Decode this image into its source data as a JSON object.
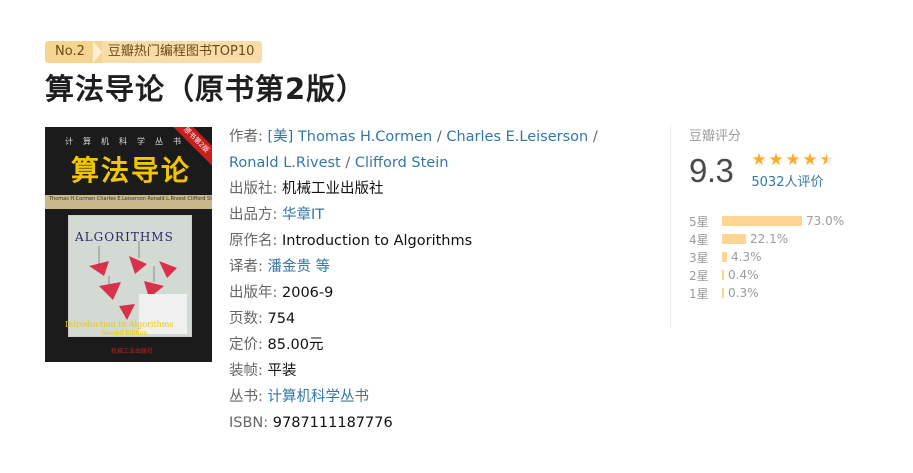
{
  "ranking": {
    "no": "No.2",
    "list": "豆瓣热门编程图书TOP10"
  },
  "title": "算法导论（原书第2版）",
  "cover": {
    "series": "计算机科学丛书",
    "title": "算法导论",
    "badge": "原书第2版",
    "authors": "Thomas H.Cormen  Charles E.Leiserson  Ronald L.Rivest  Clifford Stein",
    "algorithms": "ALGORITHMS",
    "english_title": "Introduction to Algorithms",
    "edition": "Second Edition",
    "publisher": "机械工业出版社"
  },
  "info": {
    "author_label": "作者:",
    "authors": [
      "[美] Thomas H.Cormen",
      "Charles E.Leiserson",
      "Ronald L.Rivest",
      "Clifford Stein"
    ],
    "publisher_label": "出版社:",
    "publisher": "机械工业出版社",
    "producer_label": "出品方:",
    "producer": "华章IT",
    "original_label": "原作名:",
    "original": "Introduction to Algorithms",
    "translator_label": "译者:",
    "translator": "潘金贵 等",
    "year_label": "出版年:",
    "year": "2006-9",
    "pages_label": "页数:",
    "pages": "754",
    "price_label": "定价:",
    "price": "85.00元",
    "binding_label": "装帧:",
    "binding": "平装",
    "series_label": "丛书:",
    "series": "计算机科学丛书",
    "isbn_label": "ISBN:",
    "isbn": "9787111187776"
  },
  "rating": {
    "label": "豆瓣评分",
    "score": "9.3",
    "stars_filled": 4.5,
    "votes": "5032人评价",
    "distribution": [
      {
        "label": "5星",
        "pct": "73.0%",
        "value": 73.0
      },
      {
        "label": "4星",
        "pct": "22.1%",
        "value": 22.1
      },
      {
        "label": "3星",
        "pct": "4.3%",
        "value": 4.3
      },
      {
        "label": "2星",
        "pct": "0.4%",
        "value": 0.4
      },
      {
        "label": "1星",
        "pct": "0.3%",
        "value": 0.3
      }
    ]
  },
  "colors": {
    "link": "#3377aa",
    "star": "#ffac2d",
    "bar": "#ffd596",
    "ranking_bg": "#f9dda8"
  }
}
